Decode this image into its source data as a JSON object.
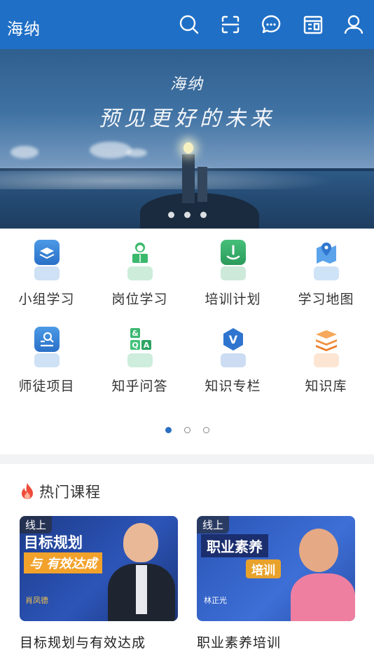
{
  "header": {
    "title": "海纳",
    "icons": [
      "search-icon",
      "scan-icon",
      "message-icon",
      "calendar-icon",
      "user-icon"
    ]
  },
  "banner": {
    "title": "海纳",
    "slogan": "预见更好的未来",
    "dots": 3
  },
  "grid": {
    "items": [
      {
        "label": "小组学习",
        "icon": "layers-icon",
        "color": "#3a86d6"
      },
      {
        "label": "岗位学习",
        "icon": "reader-icon",
        "color": "#36b86a"
      },
      {
        "label": "培训计划",
        "icon": "bookmark-icon",
        "color": "#34a86d"
      },
      {
        "label": "学习地图",
        "icon": "map-icon",
        "color": "#3f8fe0"
      },
      {
        "label": "师徒项目",
        "icon": "mentor-icon",
        "color": "#3a86d6"
      },
      {
        "label": "知乎问答",
        "icon": "qa-icon",
        "color": "#3db872"
      },
      {
        "label": "知识专栏",
        "icon": "v-badge-icon",
        "color": "#2f75cf"
      },
      {
        "label": "知识库",
        "icon": "stack-icon",
        "color": "#f2994a"
      }
    ],
    "page_dots": 3,
    "active_dot": 0
  },
  "hot": {
    "title": "热门课程",
    "icon": "fire-icon",
    "courses": [
      {
        "tag": "线上",
        "title": "目标规划与有效达成",
        "thumb_text_1": "目标规划",
        "thumb_text_2": "与 有效达成",
        "teacher": "肖凤德"
      },
      {
        "tag": "线上",
        "title": "职业素养培训",
        "thumb_text_1": "职业素养",
        "thumb_text_2": "培训",
        "teacher": "林正光"
      }
    ]
  }
}
